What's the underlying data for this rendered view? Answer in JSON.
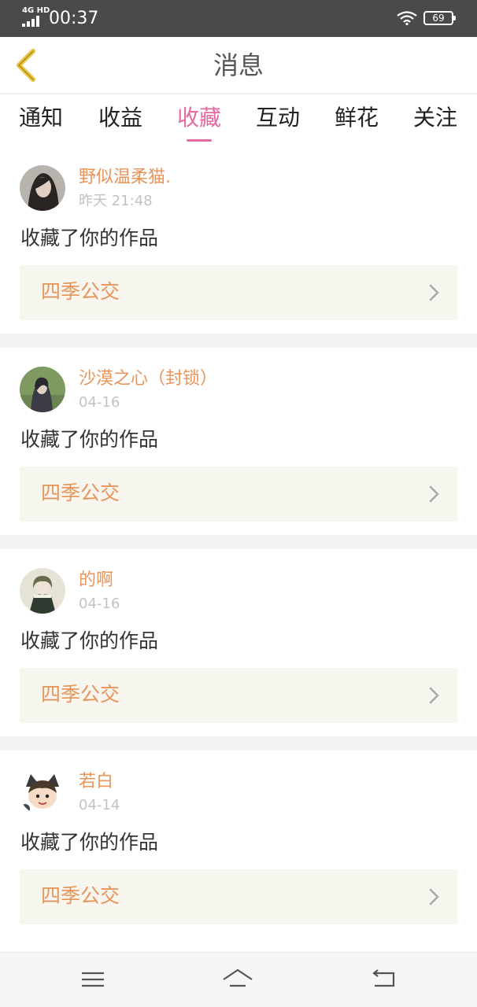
{
  "status_bar": {
    "network": "4G HD",
    "time": "00:37",
    "battery": "69"
  },
  "header": {
    "title": "消息",
    "back_icon": "chevron-left-icon"
  },
  "tabs": [
    {
      "label": "通知",
      "active": false
    },
    {
      "label": "收益",
      "active": false
    },
    {
      "label": "收藏",
      "active": true
    },
    {
      "label": "互动",
      "active": false
    },
    {
      "label": "鲜花",
      "active": false
    },
    {
      "label": "关注",
      "active": false
    }
  ],
  "messages": [
    {
      "username": "野似温柔猫.",
      "time": "昨天 21:48",
      "action": "收藏了你的作品",
      "work_title": "四季公交"
    },
    {
      "username": "沙漠之心（封锁）",
      "time": "04-16",
      "action": "收藏了你的作品",
      "work_title": "四季公交"
    },
    {
      "username": "的啊",
      "time": "04-16",
      "action": "收藏了你的作品",
      "work_title": "四季公交"
    },
    {
      "username": "若白",
      "time": "04-14",
      "action": "收藏了你的作品",
      "work_title": "四季公交"
    }
  ],
  "colors": {
    "accent_pink": "#e66aa0",
    "username_orange": "#e8945a",
    "back_icon_yellow": "#e8c23a",
    "work_box_bg": "#f6f5ee"
  },
  "system_nav": {
    "icons": [
      "menu-icon",
      "home-icon",
      "back-icon"
    ]
  }
}
